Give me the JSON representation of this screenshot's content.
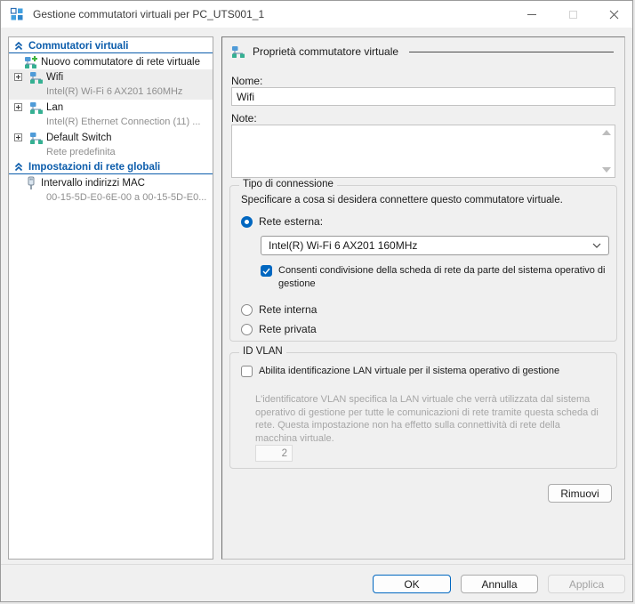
{
  "titlebar": {
    "title": "Gestione commutatori virtuali per PC_UTS001_1"
  },
  "sidebar": {
    "sections": [
      {
        "title": "Commutatori virtuali",
        "items": [
          {
            "label": "Nuovo commutatore di rete virtuale"
          },
          {
            "label": "Wifi",
            "sub": "Intel(R) Wi-Fi 6 AX201 160MHz"
          },
          {
            "label": "Lan",
            "sub": "Intel(R) Ethernet Connection (11) ..."
          },
          {
            "label": "Default Switch",
            "sub": "Rete predefinita"
          }
        ]
      },
      {
        "title": "Impostazioni di rete globali",
        "items": [
          {
            "label": "Intervallo indirizzi MAC",
            "sub": "00-15-5D-E0-6E-00 a 00-15-5D-E0..."
          }
        ]
      }
    ]
  },
  "panel": {
    "header": "Proprietà commutatore virtuale",
    "name_label": "Nome:",
    "name_value": "Wifi",
    "notes_label": "Note:",
    "connection": {
      "group_title": "Tipo di connessione",
      "instruction": "Specificare a cosa si desidera connettere questo commutatore virtuale.",
      "external_label": "Rete esterna:",
      "adapter_selected": "Intel(R) Wi-Fi 6 AX201 160MHz",
      "share_label": "Consenti condivisione della scheda di rete da parte del sistema operativo di gestione",
      "internal_label": "Rete interna",
      "private_label": "Rete privata"
    },
    "vlan": {
      "group_title": "ID VLAN",
      "enable_label": "Abilita identificazione LAN virtuale per il sistema operativo di gestione",
      "description": "L'identificatore VLAN specifica la LAN virtuale che verrà utilizzata dal sistema operativo di gestione per tutte le comunicazioni di rete tramite questa scheda di rete. Questa impostazione non ha effetto sulla connettività di rete della macchina virtuale.",
      "id_value": "2"
    },
    "remove_button": "Rimuovi"
  },
  "footer": {
    "ok": "OK",
    "cancel": "Annulla",
    "apply": "Applica"
  },
  "colors": {
    "accent": "#0067c0",
    "header_blue": "#0b5cab"
  }
}
